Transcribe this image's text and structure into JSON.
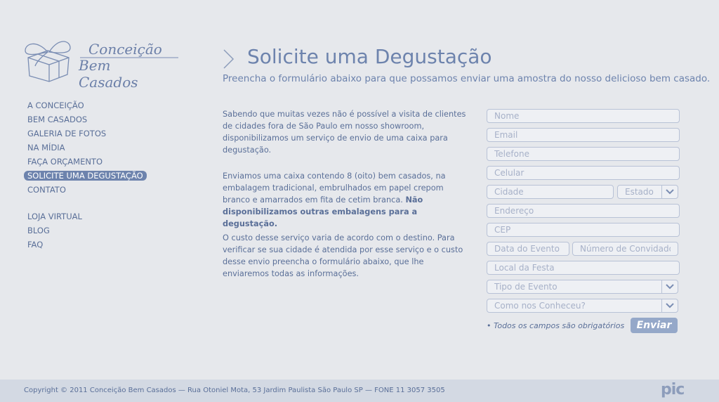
{
  "logo": {
    "line1": "Conceição",
    "line2": "Bem Casados"
  },
  "nav": {
    "items": [
      "A CONCEIÇÃO",
      "BEM CASADOS",
      "GALERIA DE FOTOS",
      "NA MÍDIA",
      "FAÇA ORÇAMENTO",
      "SOLICITE UMA DEGUSTAÇÃO",
      "CONTATO"
    ],
    "secondary": [
      "LOJA VIRTUAL",
      "BLOG",
      "FAQ"
    ],
    "active_index": 5
  },
  "page": {
    "title": "Solicite uma Degustação",
    "subtitle": "Preencha o formulário abaixo para que possamos enviar uma amostra do nosso delicioso bem casado."
  },
  "text": {
    "p1": "Sabendo que muitas vezes não é possível a visita de clientes de cidades fora de São Paulo em nosso showroom, disponibilizamos um serviço de envio de uma caixa para degustação.",
    "p2_plain": "Enviamos uma caixa contendo 8 (oito) bem casados, na embalagem tradicional, embrulhados em papel crepom branco e amarrados em fita de cetim branca. ",
    "p2_bold": "Não disponibilizamos outras embalagens para a degustação.",
    "p3": "O custo desse serviço varia de acordo com o destino. Para verificar se sua cidade é atendida por esse serviço e o custo desse envio preencha o formulário abaixo, que lhe enviaremos todas as informações."
  },
  "form": {
    "nome": "Nome",
    "email": "Email",
    "telefone": "Telefone",
    "celular": "Celular",
    "cidade": "Cidade",
    "estado": "Estado",
    "endereco": "Endereço",
    "cep": "CEP",
    "data_evento": "Data do Evento",
    "convidados": "Número de Convidados",
    "local": "Local da Festa",
    "tipo_evento": "Tipo de Evento",
    "conheceu": "Como nos Conheceu?",
    "required_note": "• Todos os campos são obrigatórios",
    "submit": "Enviar"
  },
  "footer": {
    "text": "Copyright © 2011 Conceição Bem Casados  — Rua Otoniel Mota, 53 Jardim Paulista São Paulo SP — FONE 11 3057 3505",
    "brand": "pic"
  },
  "colors": {
    "accent": "#6d83ad",
    "text": "#5a6f98",
    "background": "#e6e8ec",
    "footer": "#d3d9e3"
  }
}
